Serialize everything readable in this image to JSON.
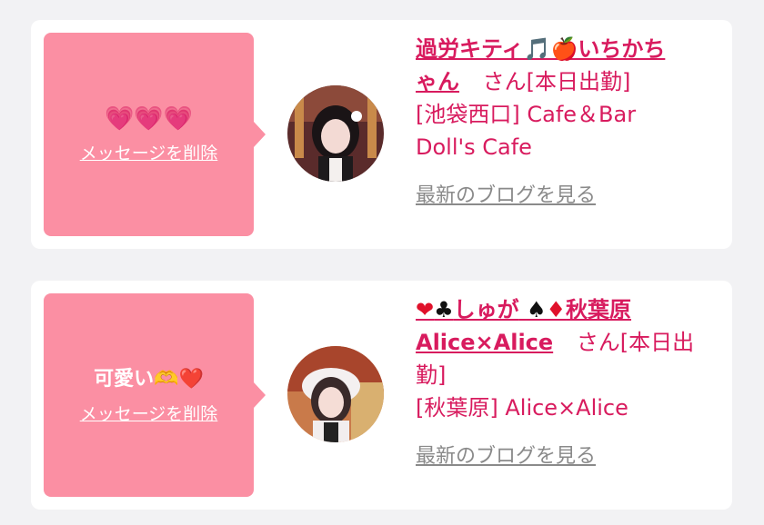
{
  "messages": [
    {
      "bubble_text": "💗💗💗",
      "delete_label": "メッセージを削除",
      "name_line1": "過労キティ🎵🍎いちかち",
      "name_line2": "ゃん",
      "suffix": "さん[本日出勤]",
      "place_line1": "[池袋西口] Cafe＆Bar",
      "place_line2": "Doll's Cafe",
      "blog_label": "最新のブログを見る"
    },
    {
      "bubble_text": "可愛い🫶❤️",
      "delete_label": "メッセージを削除",
      "name_prefix_red1": "❤",
      "name_prefix_black1": "♣",
      "name_mid": "しゅが",
      "name_prefix_black2": "♠",
      "name_prefix_red2": "♦",
      "name_place_part": "秋葉原",
      "name_line2": "Alice×Alice",
      "suffix_line1": "さん[本日出",
      "suffix_line2": "勤]",
      "place_line1": "[秋葉原] Alice×Alice",
      "blog_label": "最新のブログを見る"
    }
  ],
  "colors": {
    "bubble": "#fb8fa3",
    "accent": "#d81b5e",
    "muted": "#8a8a8a"
  }
}
